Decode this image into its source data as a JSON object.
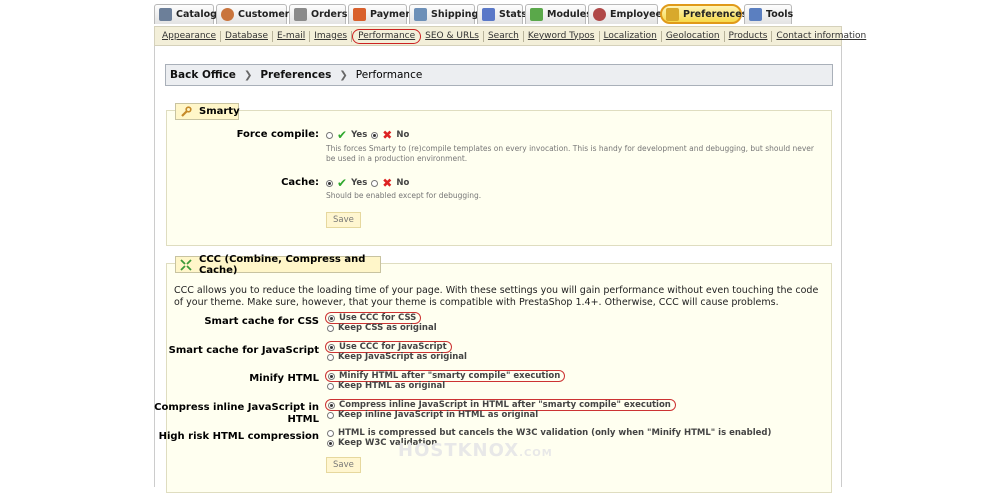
{
  "tabs": [
    {
      "label": "Catalog",
      "icon": "catalog-icon",
      "color": "#6c7f99"
    },
    {
      "label": "Customers",
      "icon": "customers-icon",
      "color": "#c9743c"
    },
    {
      "label": "Orders",
      "icon": "orders-icon",
      "color": "#8a8a8a"
    },
    {
      "label": "Payment",
      "icon": "payment-icon",
      "color": "#d9602c"
    },
    {
      "label": "Shipping",
      "icon": "shipping-icon",
      "color": "#6d90b8"
    },
    {
      "label": "Stats",
      "icon": "stats-icon",
      "color": "#5a78c8"
    },
    {
      "label": "Modules",
      "icon": "modules-icon",
      "color": "#5aa84a"
    },
    {
      "label": "Employees",
      "icon": "employees-icon",
      "color": "#b04848"
    },
    {
      "label": "Preferences",
      "icon": "preferences-icon",
      "color": "#d8a92c"
    },
    {
      "label": "Tools",
      "icon": "tools-icon",
      "color": "#5b7fc0"
    }
  ],
  "subtabs": [
    "Appearance",
    "Database",
    "E-mail",
    "Images",
    "Performance",
    "SEO & URLs",
    "Search",
    "Keyword Typos",
    "Localization",
    "Geolocation",
    "Products",
    "Contact information"
  ],
  "breadcrumb": {
    "root": "Back Office",
    "section": "Preferences",
    "current": "Performance",
    "sep": "❯"
  },
  "smarty": {
    "title": "Smarty",
    "force_compile": {
      "label": "Force compile:",
      "yes": "Yes",
      "no": "No",
      "selected": "no",
      "hint": "This forces Smarty to (re)compile templates on every invocation. This is handy for development and debugging, but should never be used in a production environment."
    },
    "cache": {
      "label": "Cache:",
      "yes": "Yes",
      "no": "No",
      "selected": "yes",
      "hint": "Should be enabled except for debugging."
    },
    "save": "Save"
  },
  "ccc": {
    "title": "CCC (Combine, Compress and Cache)",
    "description": "CCC allows you to reduce the loading time of your page. With these settings you will gain performance without even touching the code of your theme. Make sure, however, that your theme is compatible with PrestaShop 1.4+. Otherwise, CCC will cause problems.",
    "css": {
      "label": "Smart cache for CSS",
      "opt1": "Use CCC for CSS",
      "opt2": "Keep CSS as original"
    },
    "js": {
      "label": "Smart cache for JavaScript",
      "opt1": "Use CCC for JavaScript",
      "opt2": "Keep JavaScript as original"
    },
    "minify": {
      "label": "Minify HTML",
      "opt1": "Minify HTML after \"smarty compile\" execution",
      "opt2": "Keep HTML as original"
    },
    "inline_js": {
      "label_line1": "Compress inline JavaScript in",
      "label_line2": "HTML",
      "opt1": "Compress inline JavaScript in HTML after \"smarty compile\" execution",
      "opt2": "Keep inline JavaScript in HTML as original"
    },
    "high_risk": {
      "label": "High risk HTML compression",
      "opt1": "HTML is compressed but cancels the W3C validation (only when \"Minify HTML\" is enabled)",
      "opt2": "Keep W3C validation"
    },
    "save": "Save"
  },
  "watermark": {
    "brand": "HOSTKNOX",
    "domain": ".COM"
  }
}
